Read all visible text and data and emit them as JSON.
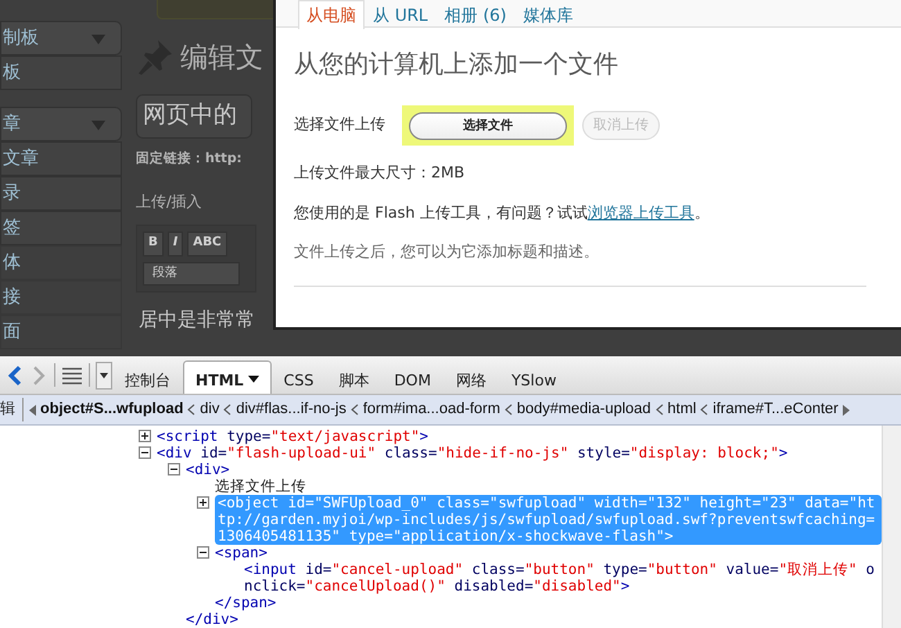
{
  "background": {
    "sidebar": [
      {
        "label": "制板",
        "kind": "header"
      },
      {
        "label": "板",
        "kind": "item"
      },
      {
        "label": "章",
        "kind": "header"
      },
      {
        "label": "文章",
        "kind": "item"
      },
      {
        "label": "录",
        "kind": "item"
      },
      {
        "label": "签",
        "kind": "item"
      },
      {
        "label": "体",
        "kind": "plain"
      },
      {
        "label": "接",
        "kind": "plain"
      },
      {
        "label": "面",
        "kind": "plain"
      }
    ],
    "editor": {
      "heading": "编辑文",
      "title_value": "网页中的",
      "permalink": "固定链接：http:",
      "upload_insert": "上传/插入",
      "format_buttons": [
        "B",
        "I",
        "ABC"
      ],
      "format_select": "段落",
      "content": "居中是非常常"
    }
  },
  "dialog": {
    "tabs": [
      {
        "label": "从电脑",
        "selected": true
      },
      {
        "label": "从 URL",
        "selected": false
      },
      {
        "label": "相册 (6)",
        "selected": false
      },
      {
        "label": "媒体库",
        "selected": false
      }
    ],
    "heading": "从您的计算机上添加一个文件",
    "upload_label": "选择文件上传",
    "choose_button": "选择文件",
    "cancel_button": {
      "label": "取消上传",
      "disabled": true
    },
    "max_size": "上传文件最大尺寸：2MB",
    "flash_note": {
      "text": "您使用的是 Flash 上传工具，有问题？试试",
      "link": "浏览器上传工具",
      "end": "。"
    },
    "after_note": "文件上传之后，您可以为它添加标题和描述。"
  },
  "devtools": {
    "tabs": [
      {
        "label": "控制台",
        "selected": false
      },
      {
        "label": "HTML",
        "selected": true
      },
      {
        "label": "CSS",
        "selected": false
      },
      {
        "label": "脚本",
        "selected": false
      },
      {
        "label": "DOM",
        "selected": false
      },
      {
        "label": "网络",
        "selected": false
      },
      {
        "label": "YSlow",
        "selected": false
      }
    ],
    "breadcrumb_label": "辑",
    "breadcrumbs": [
      {
        "label": "object#S...wfupload",
        "selected": true
      },
      {
        "label": "div",
        "selected": false
      },
      {
        "label": "div#flas...if-no-js",
        "selected": false
      },
      {
        "label": "form#ima...oad-form",
        "selected": false
      },
      {
        "label": "body#media-upload",
        "selected": false
      },
      {
        "label": "html",
        "selected": false
      },
      {
        "label": "iframe#T...eConter",
        "selected": false
      }
    ],
    "tree": [
      {
        "kind": "element",
        "expanded": false,
        "selected": false,
        "tokens": [
          {
            "kind": "tag",
            "text": "<script"
          },
          {
            "kind": "attr",
            "text": " type="
          },
          {
            "kind": "value",
            "text": "\"text/javascript\""
          },
          {
            "kind": "tag",
            "text": ">"
          }
        ]
      },
      {
        "kind": "element",
        "expanded": true,
        "selected": false,
        "tokens": [
          {
            "kind": "tag",
            "text": "<div"
          },
          {
            "kind": "attr",
            "text": " id="
          },
          {
            "kind": "value",
            "text": "\"flash-upload-ui\""
          },
          {
            "kind": "attr",
            "text": " class="
          },
          {
            "kind": "value",
            "text": "\"hide-if-no-js\""
          },
          {
            "kind": "attr",
            "text": " style="
          },
          {
            "kind": "value",
            "text": "\"display: block;\""
          },
          {
            "kind": "tag",
            "text": ">"
          }
        ],
        "children": [
          {
            "kind": "element",
            "expanded": true,
            "selected": false,
            "tokens": [
              {
                "kind": "tag",
                "text": "<div>"
              }
            ],
            "children": [
              {
                "kind": "text",
                "selected": false,
                "text": "选择文件上传"
              },
              {
                "kind": "element",
                "expanded": false,
                "selected": true,
                "tokens": [
                  {
                    "kind": "tag",
                    "text": "<object"
                  },
                  {
                    "kind": "attr",
                    "text": " id="
                  },
                  {
                    "kind": "value",
                    "text": "\"SWFUpload_0\""
                  },
                  {
                    "kind": "attr",
                    "text": " class="
                  },
                  {
                    "kind": "value",
                    "text": "\"swfupload\""
                  },
                  {
                    "kind": "attr",
                    "text": " width="
                  },
                  {
                    "kind": "value",
                    "text": "\"132\""
                  },
                  {
                    "kind": "attr",
                    "text": " height="
                  },
                  {
                    "kind": "value",
                    "text": "\"23\""
                  },
                  {
                    "kind": "attr",
                    "text": " data="
                  },
                  {
                    "kind": "value",
                    "text": "\"http://garden.myjoi/wp-includes/js/swfupload/swfupload.swf?preventswfcaching=1306405481135\""
                  },
                  {
                    "kind": "attr",
                    "text": " type="
                  },
                  {
                    "kind": "value",
                    "text": "\"application/x-shockwave-flash\""
                  },
                  {
                    "kind": "tag",
                    "text": ">"
                  }
                ]
              },
              {
                "kind": "element",
                "expanded": true,
                "selected": false,
                "tokens": [
                  {
                    "kind": "tag",
                    "text": "<span>"
                  }
                ],
                "children": [
                  {
                    "kind": "element",
                    "selected": false,
                    "tokens": [
                      {
                        "kind": "tag",
                        "text": "<input"
                      },
                      {
                        "kind": "attr",
                        "text": " id="
                      },
                      {
                        "kind": "value",
                        "text": "\"cancel-upload\""
                      },
                      {
                        "kind": "attr",
                        "text": " class="
                      },
                      {
                        "kind": "value",
                        "text": "\"button\""
                      },
                      {
                        "kind": "attr",
                        "text": " type="
                      },
                      {
                        "kind": "value",
                        "text": "\"button\""
                      },
                      {
                        "kind": "attr",
                        "text": " value="
                      },
                      {
                        "kind": "value",
                        "text": "\"取消上传\""
                      },
                      {
                        "kind": "attr",
                        "text": " onclick="
                      },
                      {
                        "kind": "value",
                        "text": "\"cancelUpload()\""
                      },
                      {
                        "kind": "attr",
                        "text": " disabled="
                      },
                      {
                        "kind": "value",
                        "text": "\"disabled\""
                      },
                      {
                        "kind": "tag",
                        "text": ">"
                      }
                    ]
                  }
                ],
                "close": "</span>"
              }
            ],
            "close": "</div>"
          }
        ]
      }
    ]
  }
}
